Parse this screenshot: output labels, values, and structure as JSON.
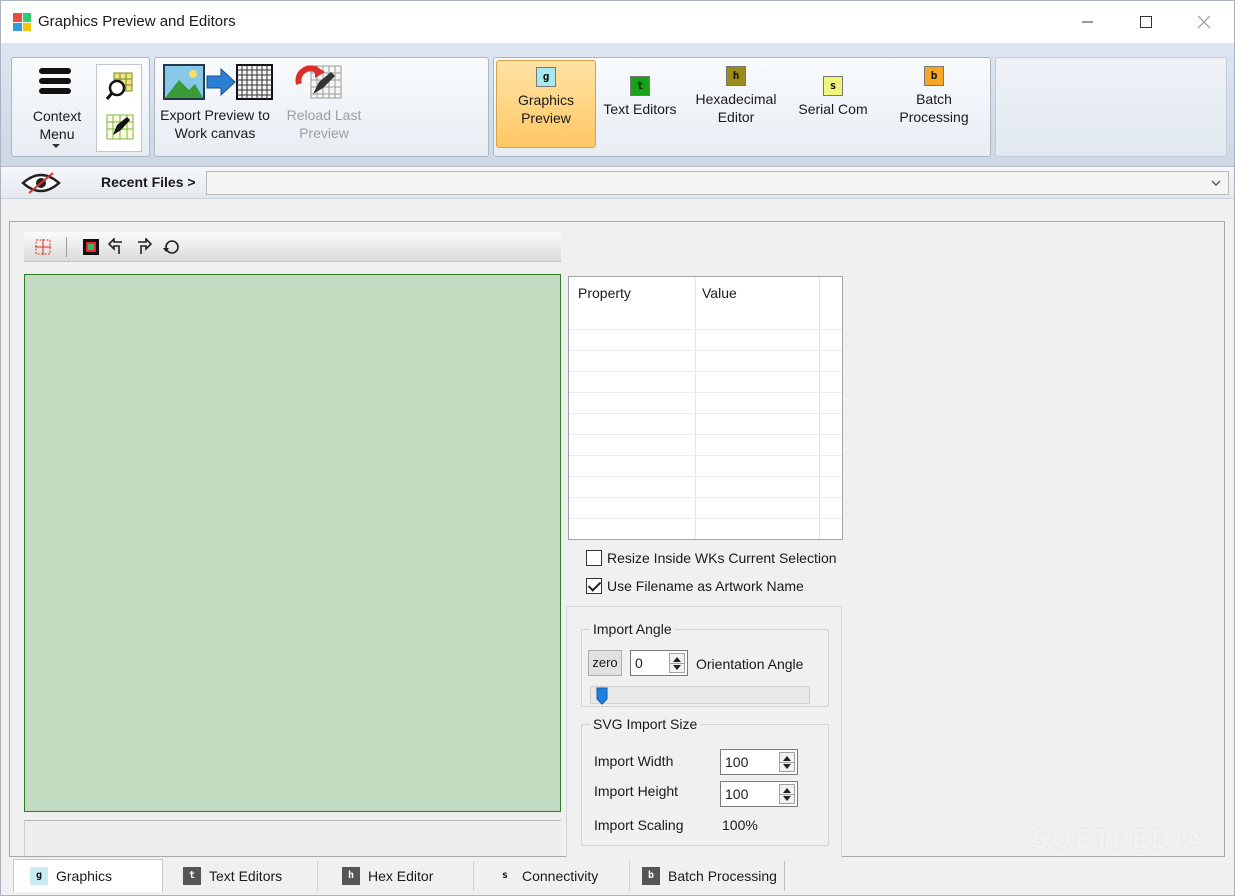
{
  "window": {
    "title": "Graphics Preview and Editors"
  },
  "colors": {
    "accent_active_tab": "#ffc766",
    "canvas_bg": "#c2dcc2",
    "canvas_border": "#2f7d2f",
    "badge_g": "#a8e8f0",
    "badge_t": "#17a317",
    "badge_h": "#9c8a1c",
    "badge_s": "#eef57a",
    "badge_b": "#f5a623"
  },
  "ribbon": {
    "context_menu": {
      "line1": "Context",
      "line2": "Menu",
      "icon": "hamburger-icon"
    },
    "export": {
      "line1": "Export Preview to",
      "line2": "Work canvas"
    },
    "reload": {
      "line1": "Reload Last",
      "line2": "Preview"
    },
    "tabs": [
      {
        "badge": "g",
        "line1": "Graphics",
        "line2": "Preview",
        "active": true
      },
      {
        "badge": "t",
        "line1": "Text Editors",
        "line2": ""
      },
      {
        "badge": "h",
        "line1": "Hexadecimal",
        "line2": "Editor"
      },
      {
        "badge": "s",
        "line1": "Serial Com",
        "line2": ""
      },
      {
        "badge": "b",
        "line1": "Batch",
        "line2": "Processing"
      }
    ]
  },
  "recent": {
    "label": "Recent Files >",
    "value": ""
  },
  "properties": {
    "col_property": "Property",
    "col_value": "Value"
  },
  "options": {
    "resize_inside": {
      "label": "Resize Inside WKs Current Selection",
      "checked": false
    },
    "use_filename": {
      "label": "Use Filename as Artwork Name",
      "checked": true
    }
  },
  "import_angle": {
    "legend": "Import Angle",
    "zero_label": "zero",
    "value": "0",
    "orientation_label": "Orientation Angle"
  },
  "svg_import": {
    "legend": "SVG Import Size",
    "width_label": "Import Width",
    "width_value": "100",
    "height_label": "Import Height",
    "height_value": "100",
    "scaling_label": "Import Scaling",
    "scaling_value": "100%"
  },
  "bottom_tabs": [
    {
      "badge": "g",
      "label": "Graphics",
      "active": true
    },
    {
      "badge": "t",
      "label": "Text Editors"
    },
    {
      "badge": "h",
      "label": "Hex Editor"
    },
    {
      "badge": "s",
      "label": "Connectivity"
    },
    {
      "badge": "b",
      "label": "Batch Processing"
    }
  ],
  "watermark": "SOFTPEDIA"
}
